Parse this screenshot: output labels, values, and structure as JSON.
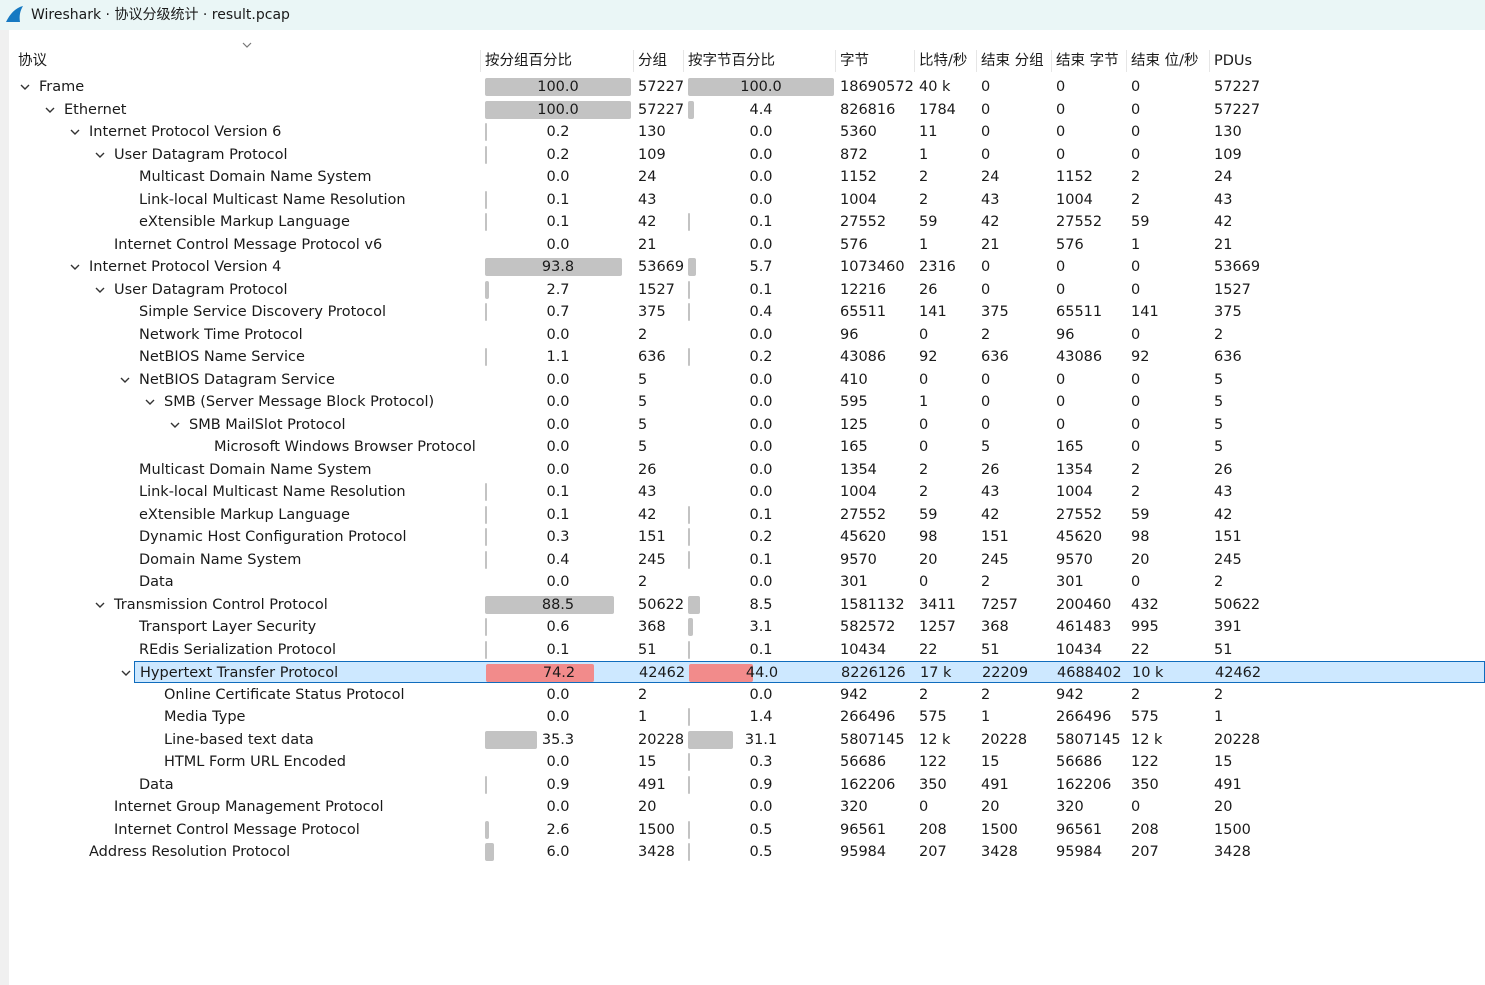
{
  "window": {
    "title": "Wireshark · 协议分级统计 · result.pcap"
  },
  "columns": [
    "协议",
    "按分组百分比",
    "分组",
    "按字节百分比",
    "字节",
    "比特/秒",
    "结束 分组",
    "结束 字节",
    "结束 位/秒",
    "PDUs"
  ],
  "rows": [
    {
      "name": "Frame",
      "level": 0,
      "expanded": true,
      "pkt_pct": "100.0",
      "pkt_pct_value": 100.0,
      "packets": "57227",
      "byte_pct": "100.0",
      "byte_pct_value": 100.0,
      "bytes": "18690572",
      "bps": "40 k",
      "end_packets": "0",
      "end_bytes": "0",
      "end_bps": "0",
      "pdus": "57227"
    },
    {
      "name": "Ethernet",
      "level": 1,
      "expanded": true,
      "pkt_pct": "100.0",
      "pkt_pct_value": 100.0,
      "packets": "57227",
      "byte_pct": "4.4",
      "byte_pct_value": 4.4,
      "bytes": "826816",
      "bps": "1784",
      "end_packets": "0",
      "end_bytes": "0",
      "end_bps": "0",
      "pdus": "57227"
    },
    {
      "name": "Internet Protocol Version 6",
      "level": 2,
      "expanded": true,
      "pkt_pct": "0.2",
      "pkt_pct_value": 0.2,
      "packets": "130",
      "byte_pct": "0.0",
      "byte_pct_value": 0.0,
      "bytes": "5360",
      "bps": "11",
      "end_packets": "0",
      "end_bytes": "0",
      "end_bps": "0",
      "pdus": "130"
    },
    {
      "name": "User Datagram Protocol",
      "level": 3,
      "expanded": true,
      "pkt_pct": "0.2",
      "pkt_pct_value": 0.2,
      "packets": "109",
      "byte_pct": "0.0",
      "byte_pct_value": 0.0,
      "bytes": "872",
      "bps": "1",
      "end_packets": "0",
      "end_bytes": "0",
      "end_bps": "0",
      "pdus": "109"
    },
    {
      "name": "Multicast Domain Name System",
      "level": 4,
      "pkt_pct": "0.0",
      "pkt_pct_value": 0.0,
      "packets": "24",
      "byte_pct": "0.0",
      "byte_pct_value": 0.0,
      "bytes": "1152",
      "bps": "2",
      "end_packets": "24",
      "end_bytes": "1152",
      "end_bps": "2",
      "pdus": "24"
    },
    {
      "name": "Link-local Multicast Name Resolution",
      "level": 4,
      "pkt_pct": "0.1",
      "pkt_pct_value": 0.1,
      "packets": "43",
      "byte_pct": "0.0",
      "byte_pct_value": 0.0,
      "bytes": "1004",
      "bps": "2",
      "end_packets": "43",
      "end_bytes": "1004",
      "end_bps": "2",
      "pdus": "43"
    },
    {
      "name": "eXtensible Markup Language",
      "level": 4,
      "pkt_pct": "0.1",
      "pkt_pct_value": 0.1,
      "packets": "42",
      "byte_pct": "0.1",
      "byte_pct_value": 0.1,
      "bytes": "27552",
      "bps": "59",
      "end_packets": "42",
      "end_bytes": "27552",
      "end_bps": "59",
      "pdus": "42"
    },
    {
      "name": "Internet Control Message Protocol v6",
      "level": 3,
      "pkt_pct": "0.0",
      "pkt_pct_value": 0.0,
      "packets": "21",
      "byte_pct": "0.0",
      "byte_pct_value": 0.0,
      "bytes": "576",
      "bps": "1",
      "end_packets": "21",
      "end_bytes": "576",
      "end_bps": "1",
      "pdus": "21"
    },
    {
      "name": "Internet Protocol Version 4",
      "level": 2,
      "expanded": true,
      "pkt_pct": "93.8",
      "pkt_pct_value": 93.8,
      "packets": "53669",
      "byte_pct": "5.7",
      "byte_pct_value": 5.7,
      "bytes": "1073460",
      "bps": "2316",
      "end_packets": "0",
      "end_bytes": "0",
      "end_bps": "0",
      "pdus": "53669"
    },
    {
      "name": "User Datagram Protocol",
      "level": 3,
      "expanded": true,
      "pkt_pct": "2.7",
      "pkt_pct_value": 2.7,
      "packets": "1527",
      "byte_pct": "0.1",
      "byte_pct_value": 0.1,
      "bytes": "12216",
      "bps": "26",
      "end_packets": "0",
      "end_bytes": "0",
      "end_bps": "0",
      "pdus": "1527"
    },
    {
      "name": "Simple Service Discovery Protocol",
      "level": 4,
      "pkt_pct": "0.7",
      "pkt_pct_value": 0.7,
      "packets": "375",
      "byte_pct": "0.4",
      "byte_pct_value": 0.4,
      "bytes": "65511",
      "bps": "141",
      "end_packets": "375",
      "end_bytes": "65511",
      "end_bps": "141",
      "pdus": "375"
    },
    {
      "name": "Network Time Protocol",
      "level": 4,
      "pkt_pct": "0.0",
      "pkt_pct_value": 0.0,
      "packets": "2",
      "byte_pct": "0.0",
      "byte_pct_value": 0.0,
      "bytes": "96",
      "bps": "0",
      "end_packets": "2",
      "end_bytes": "96",
      "end_bps": "0",
      "pdus": "2"
    },
    {
      "name": "NetBIOS Name Service",
      "level": 4,
      "pkt_pct": "1.1",
      "pkt_pct_value": 1.1,
      "packets": "636",
      "byte_pct": "0.2",
      "byte_pct_value": 0.2,
      "bytes": "43086",
      "bps": "92",
      "end_packets": "636",
      "end_bytes": "43086",
      "end_bps": "92",
      "pdus": "636"
    },
    {
      "name": "NetBIOS Datagram Service",
      "level": 4,
      "expanded": true,
      "pkt_pct": "0.0",
      "pkt_pct_value": 0.0,
      "packets": "5",
      "byte_pct": "0.0",
      "byte_pct_value": 0.0,
      "bytes": "410",
      "bps": "0",
      "end_packets": "0",
      "end_bytes": "0",
      "end_bps": "0",
      "pdus": "5"
    },
    {
      "name": "SMB (Server Message Block Protocol)",
      "level": 5,
      "expanded": true,
      "pkt_pct": "0.0",
      "pkt_pct_value": 0.0,
      "packets": "5",
      "byte_pct": "0.0",
      "byte_pct_value": 0.0,
      "bytes": "595",
      "bps": "1",
      "end_packets": "0",
      "end_bytes": "0",
      "end_bps": "0",
      "pdus": "5"
    },
    {
      "name": "SMB MailSlot Protocol",
      "level": 6,
      "expanded": true,
      "pkt_pct": "0.0",
      "pkt_pct_value": 0.0,
      "packets": "5",
      "byte_pct": "0.0",
      "byte_pct_value": 0.0,
      "bytes": "125",
      "bps": "0",
      "end_packets": "0",
      "end_bytes": "0",
      "end_bps": "0",
      "pdus": "5"
    },
    {
      "name": "Microsoft Windows Browser Protocol",
      "level": 7,
      "pkt_pct": "0.0",
      "pkt_pct_value": 0.0,
      "packets": "5",
      "byte_pct": "0.0",
      "byte_pct_value": 0.0,
      "bytes": "165",
      "bps": "0",
      "end_packets": "5",
      "end_bytes": "165",
      "end_bps": "0",
      "pdus": "5"
    },
    {
      "name": "Multicast Domain Name System",
      "level": 4,
      "pkt_pct": "0.0",
      "pkt_pct_value": 0.0,
      "packets": "26",
      "byte_pct": "0.0",
      "byte_pct_value": 0.0,
      "bytes": "1354",
      "bps": "2",
      "end_packets": "26",
      "end_bytes": "1354",
      "end_bps": "2",
      "pdus": "26"
    },
    {
      "name": "Link-local Multicast Name Resolution",
      "level": 4,
      "pkt_pct": "0.1",
      "pkt_pct_value": 0.1,
      "packets": "43",
      "byte_pct": "0.0",
      "byte_pct_value": 0.0,
      "bytes": "1004",
      "bps": "2",
      "end_packets": "43",
      "end_bytes": "1004",
      "end_bps": "2",
      "pdus": "43"
    },
    {
      "name": "eXtensible Markup Language",
      "level": 4,
      "pkt_pct": "0.1",
      "pkt_pct_value": 0.1,
      "packets": "42",
      "byte_pct": "0.1",
      "byte_pct_value": 0.1,
      "bytes": "27552",
      "bps": "59",
      "end_packets": "42",
      "end_bytes": "27552",
      "end_bps": "59",
      "pdus": "42"
    },
    {
      "name": "Dynamic Host Configuration Protocol",
      "level": 4,
      "pkt_pct": "0.3",
      "pkt_pct_value": 0.3,
      "packets": "151",
      "byte_pct": "0.2",
      "byte_pct_value": 0.2,
      "bytes": "45620",
      "bps": "98",
      "end_packets": "151",
      "end_bytes": "45620",
      "end_bps": "98",
      "pdus": "151"
    },
    {
      "name": "Domain Name System",
      "level": 4,
      "pkt_pct": "0.4",
      "pkt_pct_value": 0.4,
      "packets": "245",
      "byte_pct": "0.1",
      "byte_pct_value": 0.1,
      "bytes": "9570",
      "bps": "20",
      "end_packets": "245",
      "end_bytes": "9570",
      "end_bps": "20",
      "pdus": "245"
    },
    {
      "name": "Data",
      "level": 4,
      "pkt_pct": "0.0",
      "pkt_pct_value": 0.0,
      "packets": "2",
      "byte_pct": "0.0",
      "byte_pct_value": 0.0,
      "bytes": "301",
      "bps": "0",
      "end_packets": "2",
      "end_bytes": "301",
      "end_bps": "0",
      "pdus": "2"
    },
    {
      "name": "Transmission Control Protocol",
      "level": 3,
      "expanded": true,
      "pkt_pct": "88.5",
      "pkt_pct_value": 88.5,
      "packets": "50622",
      "byte_pct": "8.5",
      "byte_pct_value": 8.5,
      "bytes": "1581132",
      "bps": "3411",
      "end_packets": "7257",
      "end_bytes": "200460",
      "end_bps": "432",
      "pdus": "50622"
    },
    {
      "name": "Transport Layer Security",
      "level": 4,
      "pkt_pct": "0.6",
      "pkt_pct_value": 0.6,
      "packets": "368",
      "byte_pct": "3.1",
      "byte_pct_value": 3.1,
      "bytes": "582572",
      "bps": "1257",
      "end_packets": "368",
      "end_bytes": "461483",
      "end_bps": "995",
      "pdus": "391"
    },
    {
      "name": "REdis Serialization Protocol",
      "level": 4,
      "pkt_pct": "0.1",
      "pkt_pct_value": 0.1,
      "packets": "51",
      "byte_pct": "0.1",
      "byte_pct_value": 0.1,
      "bytes": "10434",
      "bps": "22",
      "end_packets": "51",
      "end_bytes": "10434",
      "end_bps": "22",
      "pdus": "51"
    },
    {
      "name": "Hypertext Transfer Protocol",
      "level": 4,
      "expanded": true,
      "selected": true,
      "pkt_pct": "74.2",
      "pkt_pct_value": 74.2,
      "packets": "42462",
      "byte_pct": "44.0",
      "byte_pct_value": 44.0,
      "bytes": "8226126",
      "bps": "17 k",
      "end_packets": "22209",
      "end_bytes": "4688402",
      "end_bps": "10 k",
      "pdus": "42462"
    },
    {
      "name": "Online Certificate Status Protocol",
      "level": 5,
      "pkt_pct": "0.0",
      "pkt_pct_value": 0.0,
      "packets": "2",
      "byte_pct": "0.0",
      "byte_pct_value": 0.0,
      "bytes": "942",
      "bps": "2",
      "end_packets": "2",
      "end_bytes": "942",
      "end_bps": "2",
      "pdus": "2"
    },
    {
      "name": "Media Type",
      "level": 5,
      "pkt_pct": "0.0",
      "pkt_pct_value": 0.0,
      "packets": "1",
      "byte_pct": "1.4",
      "byte_pct_value": 1.4,
      "bytes": "266496",
      "bps": "575",
      "end_packets": "1",
      "end_bytes": "266496",
      "end_bps": "575",
      "pdus": "1"
    },
    {
      "name": "Line-based text data",
      "level": 5,
      "pkt_pct": "35.3",
      "pkt_pct_value": 35.3,
      "packets": "20228",
      "byte_pct": "31.1",
      "byte_pct_value": 31.1,
      "bytes": "5807145",
      "bps": "12 k",
      "end_packets": "20228",
      "end_bytes": "5807145",
      "end_bps": "12 k",
      "pdus": "20228"
    },
    {
      "name": "HTML Form URL Encoded",
      "level": 5,
      "pkt_pct": "0.0",
      "pkt_pct_value": 0.0,
      "packets": "15",
      "byte_pct": "0.3",
      "byte_pct_value": 0.3,
      "bytes": "56686",
      "bps": "122",
      "end_packets": "15",
      "end_bytes": "56686",
      "end_bps": "122",
      "pdus": "15"
    },
    {
      "name": "Data",
      "level": 4,
      "pkt_pct": "0.9",
      "pkt_pct_value": 0.9,
      "packets": "491",
      "byte_pct": "0.9",
      "byte_pct_value": 0.9,
      "bytes": "162206",
      "bps": "350",
      "end_packets": "491",
      "end_bytes": "162206",
      "end_bps": "350",
      "pdus": "491"
    },
    {
      "name": "Internet Group Management Protocol",
      "level": 3,
      "pkt_pct": "0.0",
      "pkt_pct_value": 0.0,
      "packets": "20",
      "byte_pct": "0.0",
      "byte_pct_value": 0.0,
      "bytes": "320",
      "bps": "0",
      "end_packets": "20",
      "end_bytes": "320",
      "end_bps": "0",
      "pdus": "20"
    },
    {
      "name": "Internet Control Message Protocol",
      "level": 3,
      "pkt_pct": "2.6",
      "pkt_pct_value": 2.6,
      "packets": "1500",
      "byte_pct": "0.5",
      "byte_pct_value": 0.5,
      "bytes": "96561",
      "bps": "208",
      "end_packets": "1500",
      "end_bytes": "96561",
      "end_bps": "208",
      "pdus": "1500"
    },
    {
      "name": "Address Resolution Protocol",
      "level": 2,
      "pkt_pct": "6.0",
      "pkt_pct_value": 6.0,
      "packets": "3428",
      "byte_pct": "0.5",
      "byte_pct_value": 0.5,
      "bytes": "95984",
      "bps": "207",
      "end_packets": "3428",
      "end_bytes": "95984",
      "end_bps": "207",
      "pdus": "3428"
    }
  ],
  "colors": {
    "bar": "#c3c3c3",
    "bar_selected": "#f28b8b",
    "selection_bg": "#cde8ff",
    "selection_border": "#0f6cbd",
    "titlebar_bg": "#eaf6f6"
  },
  "icons": {
    "app": "wireshark-fin-icon",
    "expanded": "chevron-down-icon",
    "sort": "sort-descending-icon"
  }
}
